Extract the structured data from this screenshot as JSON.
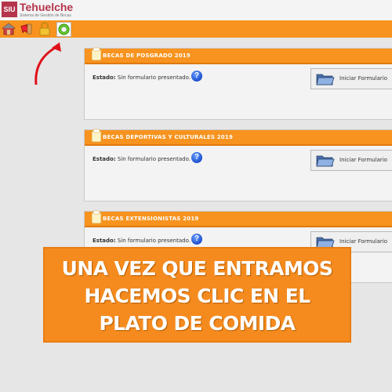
{
  "app": {
    "logo_abbr": "SIU",
    "logo_name": "Tehuelche",
    "logo_subtitle": "Sistema de Gestión de Becas"
  },
  "toolbar": {
    "icons": [
      "home-icon",
      "exit-icon",
      "lock-icon",
      "food-plate-icon"
    ]
  },
  "cards": [
    {
      "title": "BECAS DE POSGRADO 2019",
      "estado_label": "Estado:",
      "estado_value": "Sin formulario presentado.",
      "button_label": "Iniciar Formulario"
    },
    {
      "title": "BECAS DEPORTIVAS Y CULTURALES 2019",
      "estado_label": "Estado:",
      "estado_value": "Sin formulario presentado.",
      "button_label": "Iniciar Formulario"
    },
    {
      "title": "BECAS EXTENSIONISTAS 2019",
      "estado_label": "Estado:",
      "estado_value": "Sin formulario presentado.",
      "button_label": "Iniciar Formulario"
    }
  ],
  "banner": {
    "line1": "UNA VEZ QUE ENTRAMOS",
    "line2": "HACEMOS CLIC EN EL",
    "line3": "PLATO DE COMIDA"
  },
  "colors": {
    "accent_orange": "#f7931e",
    "brand": "#b5344c",
    "arrow": "#e0101a"
  }
}
